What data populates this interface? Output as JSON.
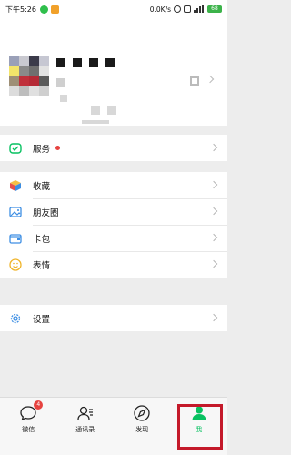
{
  "status_bar": {
    "time": "下午5:26",
    "network_speed": "0.0K/s",
    "battery": "68"
  },
  "menu": {
    "group1": [
      {
        "id": "services",
        "label": "服务",
        "icon": "services-icon",
        "has_dot": true
      }
    ],
    "group2": [
      {
        "id": "favorites",
        "label": "收藏",
        "icon": "favorites-cube-icon"
      },
      {
        "id": "moments",
        "label": "朋友圈",
        "icon": "moments-photo-icon"
      },
      {
        "id": "cards",
        "label": "卡包",
        "icon": "card-wallet-icon"
      },
      {
        "id": "stickers",
        "label": "表情",
        "icon": "smiley-icon"
      }
    ],
    "group3": [
      {
        "id": "settings",
        "label": "设置",
        "icon": "gear-icon"
      }
    ]
  },
  "tabbar": {
    "tabs": [
      {
        "id": "chats",
        "label": "微信",
        "icon": "chat-bubble-icon",
        "badge": "4"
      },
      {
        "id": "contacts",
        "label": "通讯录",
        "icon": "contacts-icon"
      },
      {
        "id": "discover",
        "label": "发现",
        "icon": "compass-icon"
      },
      {
        "id": "me",
        "label": "我",
        "icon": "person-icon",
        "active": true
      }
    ]
  },
  "colors": {
    "accent_green": "#07c160",
    "highlight_red": "#c4192a",
    "badge_red": "#e64340"
  }
}
